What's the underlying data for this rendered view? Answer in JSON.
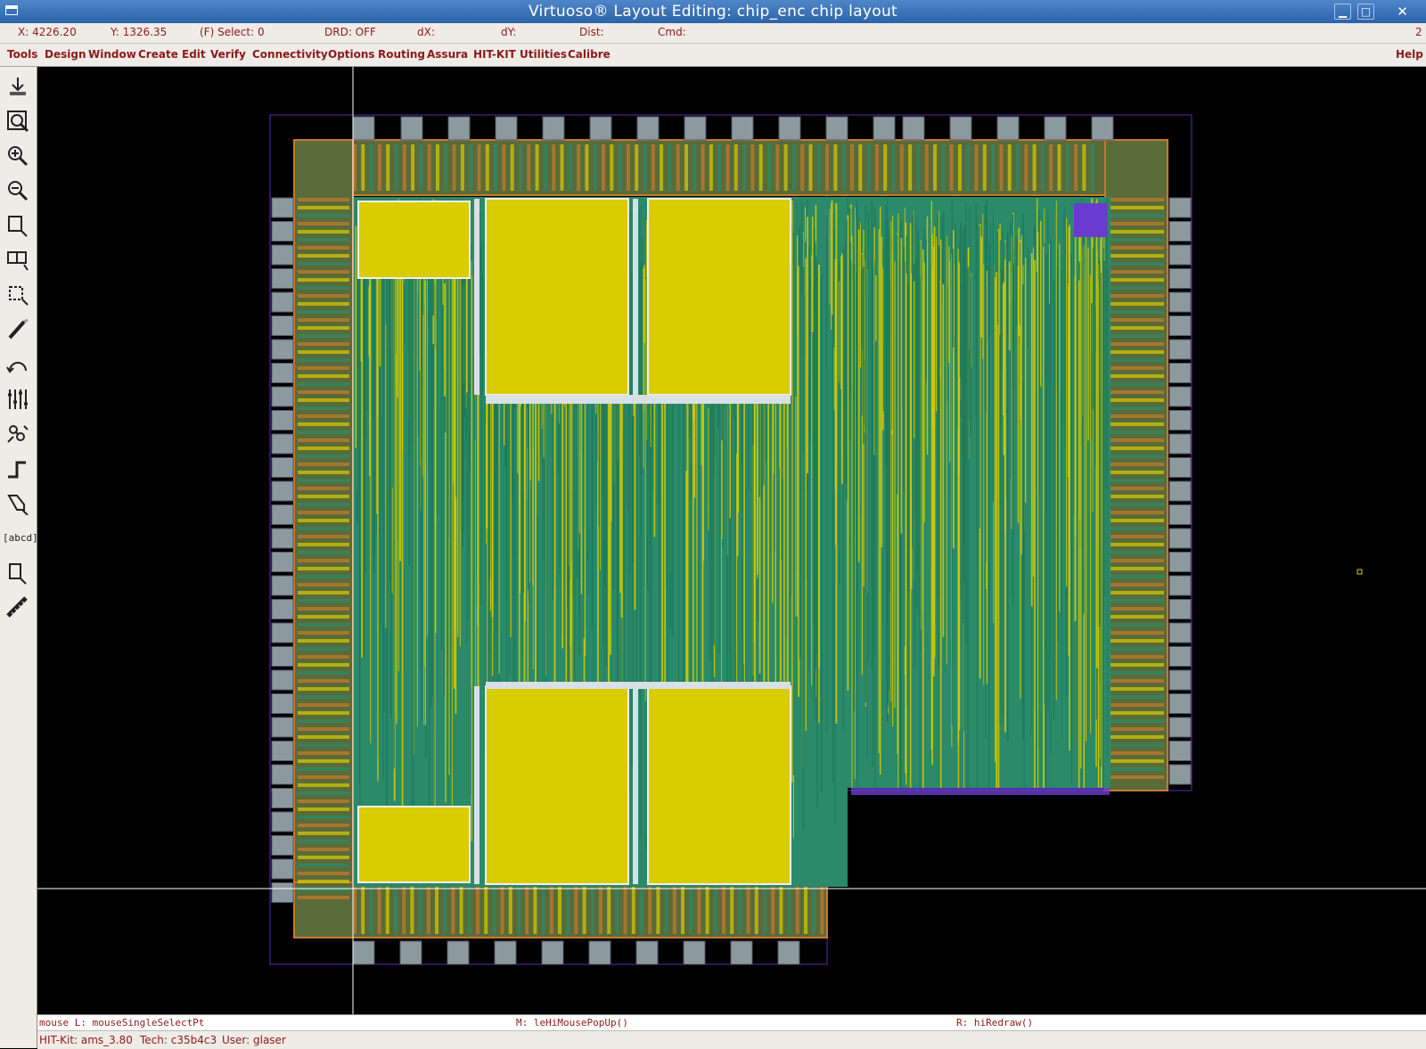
{
  "window": {
    "title": "Virtuoso® Layout Editing: chip_enc chip layout",
    "minimize_glyph": "▁",
    "maximize_glyph": "□",
    "close_glyph": "✕"
  },
  "status": {
    "x": "X:  4226.20",
    "y": "Y:  1326.35",
    "select": "(F) Select: 0",
    "drd": "DRD: OFF",
    "dx": "dX:",
    "dy": "dY:",
    "dist": "Dist:",
    "cmd": "Cmd:",
    "window_number": "2"
  },
  "menu": {
    "items": [
      "Tools",
      "Design",
      "Window",
      "Create",
      "Edit",
      "Verify",
      "Connectivity",
      "Options",
      "Routing",
      "Assura",
      "HIT-KIT Utilities",
      "Calibre"
    ],
    "help": "Help"
  },
  "toolbar": {
    "icons": [
      "save-icon",
      "fit-view-icon",
      "zoom-in-icon",
      "zoom-out-icon",
      "stretch-icon",
      "copy-icon",
      "move-icon",
      "delete-icon",
      "undo-icon",
      "properties-icon",
      "search-icon",
      "path-icon",
      "polygon-icon",
      "label-icon",
      "instance-icon",
      "ruler-icon"
    ],
    "label_tool_text": "[abcd]"
  },
  "mouse_bindings": {
    "left": "mouse L: mouseSingleSelectPt",
    "middle": "M: leHiMousePopUp()",
    "right": "R: hiRedraw()"
  },
  "info": {
    "hitkit": "HIT-Kit: ams_3.80",
    "tech": "Tech: c35b4c3",
    "user": "User: glaser"
  },
  "colors": {
    "metal_yellow": "#d9cc00",
    "metal_teal": "#2a8a6a",
    "pad_gray": "#8c9aa0",
    "boundary_purple": "#5a2db0",
    "ring_orange": "#c87a2a",
    "label_red": "#8b1a1a"
  }
}
